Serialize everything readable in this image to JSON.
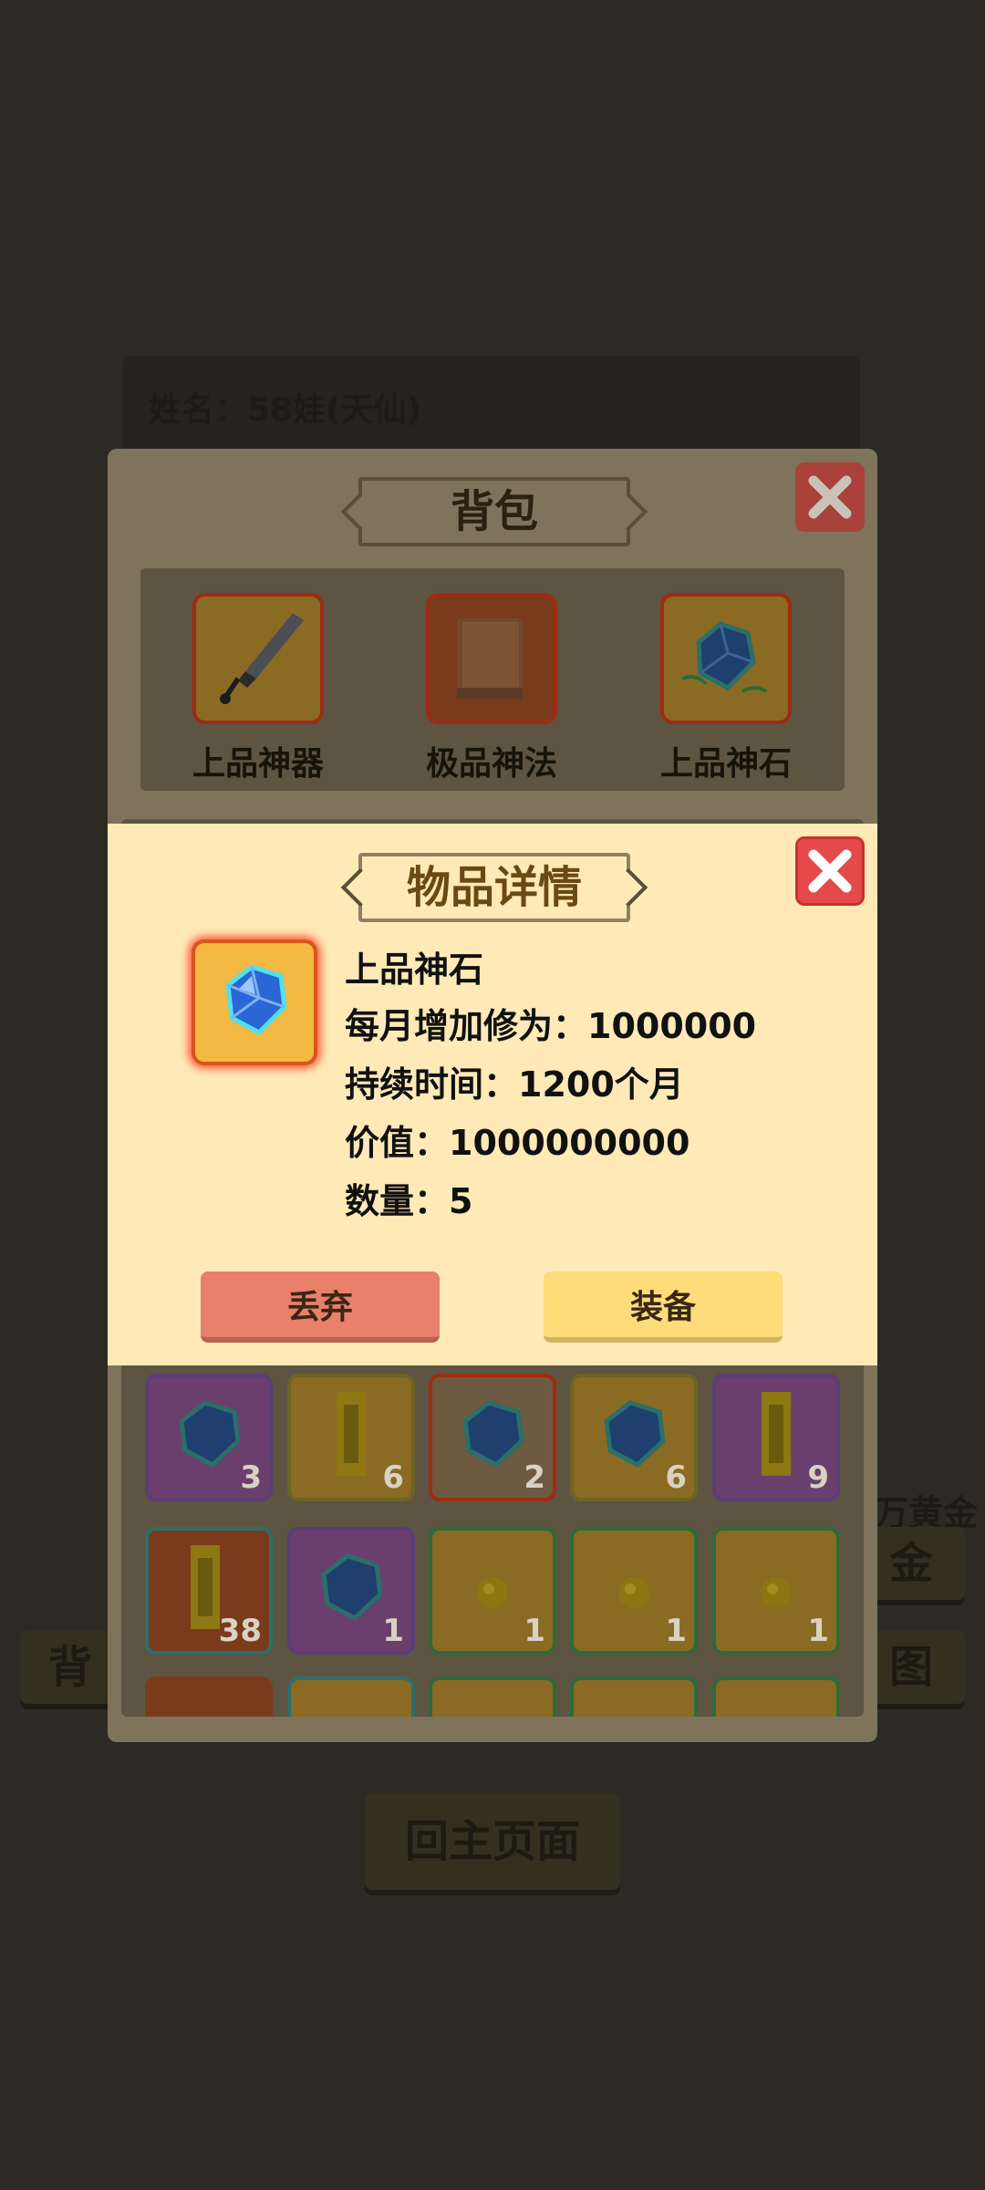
{
  "background": {
    "player_name": "姓名：58娃(天仙)",
    "gold_text": "万黄金",
    "right_btn_1": "金",
    "right_btn_2": "图",
    "left_btn": "背",
    "home_button": "回主页面"
  },
  "bag": {
    "title": "背包",
    "tabs": [
      {
        "label": "上品神器",
        "icon": "sword-icon"
      },
      {
        "label": "极品神法",
        "icon": "book-icon"
      },
      {
        "label": "上品神石",
        "icon": "crystal-icon"
      }
    ],
    "grid_row1": [
      {
        "icon": "crystal-icon",
        "count": "3",
        "rarity": "purple"
      },
      {
        "icon": "talisman-icon",
        "count": "6",
        "rarity": "yellow"
      },
      {
        "icon": "crystal-icon",
        "count": "2",
        "rarity": "red"
      },
      {
        "icon": "crystal-icon",
        "count": "6",
        "rarity": "yellow"
      },
      {
        "icon": "talisman-icon",
        "count": "9",
        "rarity": "purple"
      }
    ],
    "grid_row2": [
      {
        "icon": "talisman-icon",
        "count": "38",
        "rarity": "red"
      },
      {
        "icon": "crystal-icon",
        "count": "1",
        "rarity": "purple"
      },
      {
        "icon": "gold-coin-icon",
        "count": "1",
        "rarity": "green"
      },
      {
        "icon": "gold-coin-icon",
        "count": "1",
        "rarity": "green"
      },
      {
        "icon": "gold-coin-icon",
        "count": "1",
        "rarity": "green"
      }
    ]
  },
  "detail": {
    "title": "物品详情",
    "item_name": "上品神石",
    "line_cultivation": "每月增加修为：1000000",
    "line_duration": "持续时间：1200个月",
    "line_value": "价值：1000000000",
    "line_quantity": "数量：5",
    "discard_label": "丢弃",
    "equip_label": "装备"
  },
  "colors": {
    "dialog_bg": "#ffeab7",
    "close_red": "#e5494a",
    "discard": "#e8806c",
    "equip": "#ffdc7a"
  }
}
